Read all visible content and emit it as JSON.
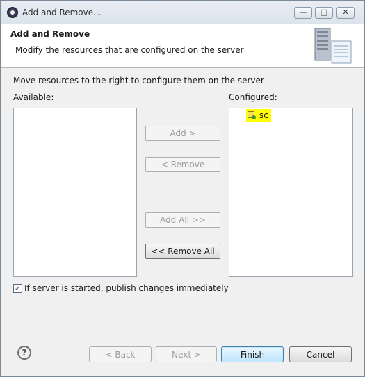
{
  "window": {
    "title": "Add and Remove...",
    "controls": {
      "minimize": "—",
      "maximize": "□",
      "close": "✕"
    }
  },
  "header": {
    "title": "Add and Remove",
    "description": "Modify the resources that are configured on the server",
    "graphic": "server-icon"
  },
  "main": {
    "hint": "Move resources to the right to configure them on the server",
    "available_label": "Available:",
    "configured_label": "Configured:",
    "available_items": [],
    "configured_items": [
      {
        "label": "sc",
        "icon": "web-module-icon",
        "selected": true,
        "highlight": "#ffff00"
      }
    ],
    "buttons": {
      "add": "Add >",
      "remove": "< Remove",
      "add_all": "Add All >>",
      "remove_all": "<< Remove All"
    },
    "publish_checkbox": {
      "label": "If server is started, publish changes immediately",
      "checked": true
    }
  },
  "footer": {
    "help": "?",
    "back": "< Back",
    "next": "Next >",
    "finish": "Finish",
    "cancel": "Cancel"
  }
}
